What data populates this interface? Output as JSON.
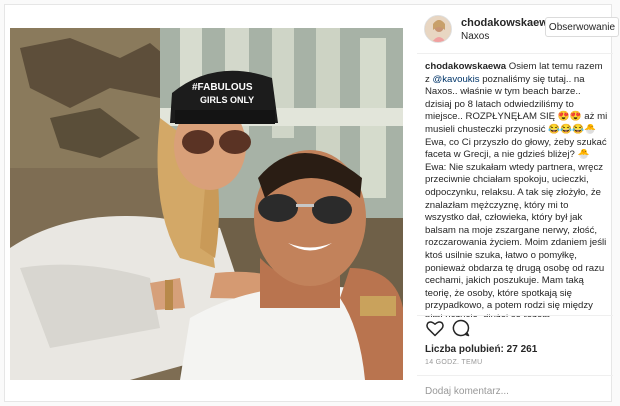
{
  "post": {
    "username": "chodakowskaew",
    "location": "Naxos",
    "follow_label": "Obserwowanie",
    "photo_cap_text": "#FABULOUS GIRLS ONLY"
  },
  "caption": {
    "username": "chodakowskaewa",
    "part1": " Osiem lat temu razem z ",
    "mention": "@kavoukis",
    "part2": " poznaliśmy się tutaj.. na Naxos.. właśnie w tym beach barze.. dzisiaj po 8 latach odwiedziliśmy to miejsce.. ROZPŁYNĘŁAM SIĘ 😍😍 aż mi musieli chusteczki przynosić 😂😂😂🐣 Ewa, co Ci przyszło do głowy, żeby szukać faceta w Grecji, a nie gdzieś bliżej? 🐣 Ewa: Nie szukałam  wtedy partnera, wręcz przeciwnie chciałam spokoju, ucieczki, odpoczynku, relaksu. A tak się złożyło, że znalazłam mężczyznę, który mi to wszystko dał, człowieka, który był jak balsam na moje zszargane nerwy, złość, rozczarowania życiem. Moim zdaniem jeśli ktoś usilnie szuka, łatwo o pomyłkę, ponieważ obdarza tę drugą osobę od razu cechami, jakich poszukuje. Mam taką teorię, że osoby, które spotkają się przypadkowo, a potem rodzi się między nimi uczucie, dłużej są razem."
  },
  "stats": {
    "likes": "Liczba polubień: 27 261",
    "time": "14 GODZ. TEMU"
  },
  "comment": {
    "placeholder": "Dodaj komentarz..."
  },
  "icons": {
    "like": "heart-icon",
    "comment": "speech-bubble-icon"
  }
}
